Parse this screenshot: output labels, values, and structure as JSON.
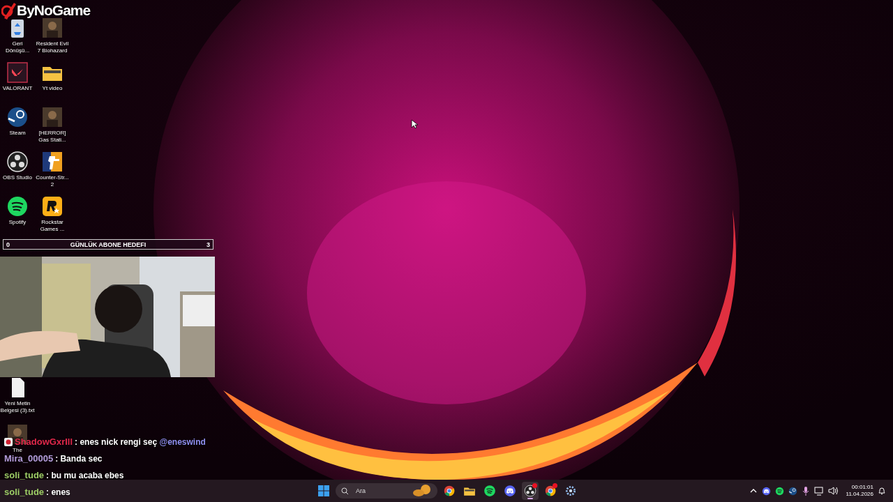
{
  "overlay_logo": {
    "text": "ByNoGame"
  },
  "desktop_icons": [
    {
      "label": "Geri Dönüşü...",
      "kind": "recycle"
    },
    {
      "label": "Resident Evil 7 Biohazard",
      "kind": "game"
    },
    {
      "label": "VALORANT",
      "kind": "valorant"
    },
    {
      "label": "Yt video",
      "kind": "folder"
    },
    {
      "label": "Steam",
      "kind": "steam"
    },
    {
      "label": "[HERROR] Gas Stati...",
      "kind": "game"
    },
    {
      "label": "OBS Studio",
      "kind": "obs"
    },
    {
      "label": "Counter-Str... 2",
      "kind": "cs"
    },
    {
      "label": "Spotify",
      "kind": "spotify"
    },
    {
      "label": "Rockstar Games ...",
      "kind": "rockstar"
    }
  ],
  "lower_icons": [
    {
      "label": "Yeni Metin Belgesi (3).txt",
      "kind": "file"
    },
    {
      "label": "The",
      "kind": "game"
    }
  ],
  "goal": {
    "start": "0",
    "title": "GÜNLÜK ABONE HEDEFI",
    "target": "3"
  },
  "chat": [
    {
      "user": "ShadowGxrIll",
      "color": "#e0284a",
      "text": ": enes nick rengi seç",
      "mention": "@eneswind",
      "badge": true
    },
    {
      "user": "Mira_00005",
      "color": "#b39ddb",
      "text": ": Banda sec",
      "badge": false
    },
    {
      "user": "soli_tude",
      "color": "#9ccc65",
      "text": ": bu mu acaba ebes",
      "badge": false
    },
    {
      "user": "soli_tude",
      "color": "#9ccc65",
      "text": ": enes",
      "badge": false
    }
  ],
  "taskbar": {
    "search_placeholder": "Ara",
    "apps": [
      {
        "kind": "chrome",
        "active": false,
        "badge": false
      },
      {
        "kind": "folder",
        "active": false,
        "badge": false
      },
      {
        "kind": "spotify",
        "active": false,
        "badge": false
      },
      {
        "kind": "discord",
        "active": false,
        "badge": false
      },
      {
        "kind": "obs",
        "active": true,
        "badge": true
      },
      {
        "kind": "chrome",
        "active": false,
        "badge": true
      },
      {
        "kind": "settings",
        "active": false,
        "badge": false
      }
    ],
    "time": "00:01:01",
    "date": "11.04.2026"
  }
}
